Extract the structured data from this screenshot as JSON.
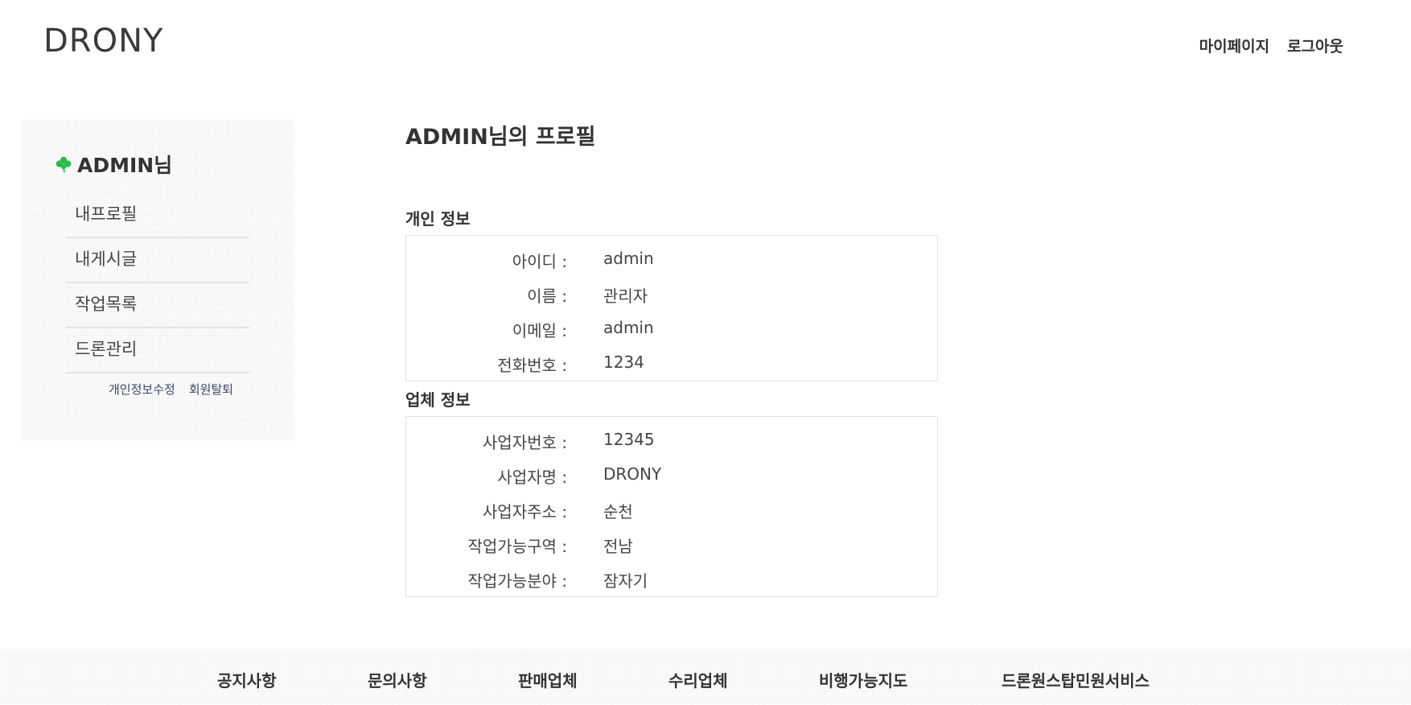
{
  "header": {
    "logo": "DRONY",
    "nav": [
      "마이페이지",
      "로그아웃"
    ]
  },
  "sidebar": {
    "user_name": "ADMIN님",
    "user_icon": "clover-icon",
    "menu": [
      "내프로필",
      "내게시글",
      "작업목록",
      "드론관리"
    ],
    "links": [
      "개인정보수정",
      "회원탈퇴"
    ],
    "accent_color": "#2dbb4e"
  },
  "main": {
    "title": "ADMIN님의 프로필",
    "personal_section_title": "개인 정보",
    "personal": [
      {
        "label": "아이디 :",
        "value": "admin"
      },
      {
        "label": "이름 :",
        "value": "관리자"
      },
      {
        "label": "이메일 :",
        "value": "admin"
      },
      {
        "label": "전화번호 :",
        "value": "1234"
      }
    ],
    "company_section_title": "업체 정보",
    "company": [
      {
        "label": "사업자번호 :",
        "value": "12345"
      },
      {
        "label": "사업자명 :",
        "value": "DRONY"
      },
      {
        "label": "사업자주소 :",
        "value": "순천"
      },
      {
        "label": "작업가능구역 :",
        "value": "전남"
      },
      {
        "label": "작업가능분야 :",
        "value": "잠자기"
      }
    ]
  },
  "footer": {
    "nav": [
      "공지사항",
      "문의사항",
      "판매업체",
      "수리업체",
      "비행가능지도",
      "드론원스탑민원서비스"
    ]
  }
}
